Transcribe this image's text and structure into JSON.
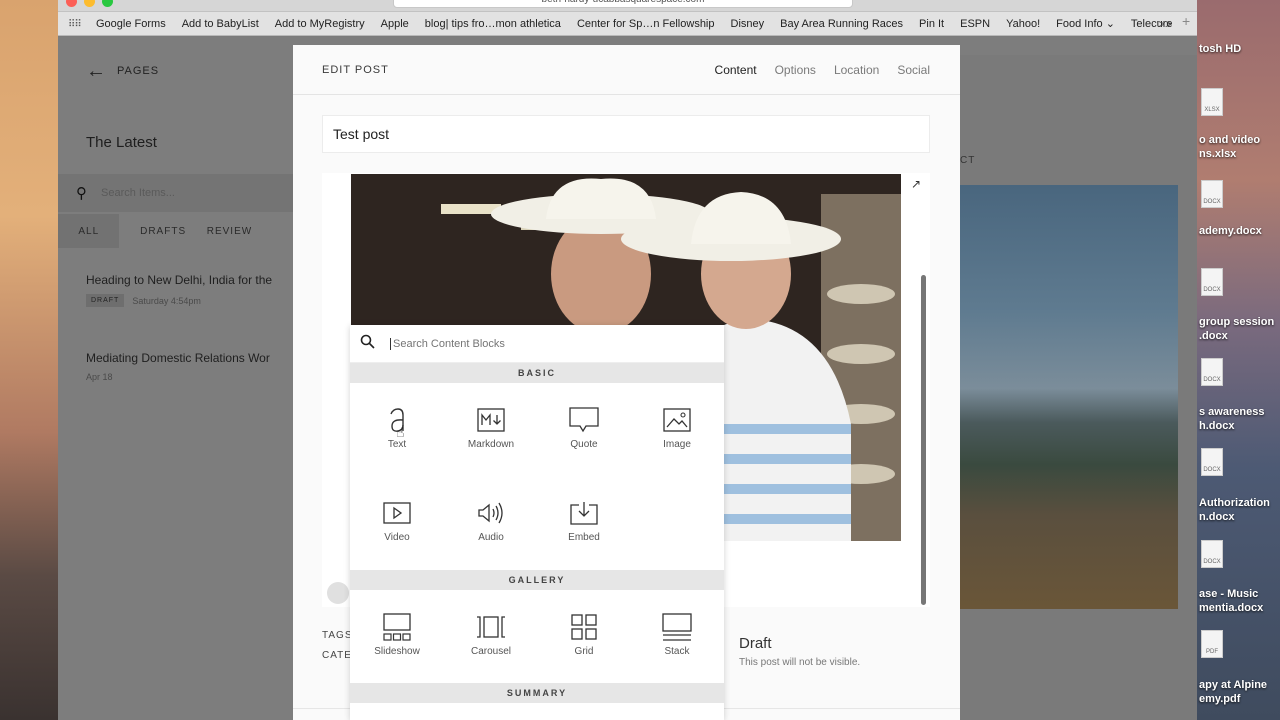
{
  "browser": {
    "url_text": "beth-hardy-ucabbasquarespace.com",
    "bookmarks": [
      "Google Forms",
      "Add to BabyList",
      "Add to MyRegistry",
      "Apple",
      "blog| tips fro…mon athletica",
      "Center for Sp…n Fellowship",
      "Disney",
      "Bay Area Running Races",
      "Pin It",
      "ESPN",
      "Yahoo!",
      "Food Info ⌄",
      "Telecure"
    ],
    "more": ">>",
    "plus": "+"
  },
  "sidebar": {
    "back_label": "PAGES",
    "title": "The Latest",
    "search_placeholder": "Search Items...",
    "tabs": [
      "ALL",
      "DRAFTS",
      "REVIEW"
    ],
    "posts": [
      {
        "title": "Heading to New Delhi, India for the",
        "badge": "DRAFT",
        "date": "Saturday 4:54pm"
      },
      {
        "title": "Mediating Domestic Relations Wor",
        "badge": "",
        "date": "Apr 18"
      }
    ]
  },
  "preview": {
    "label": "CT"
  },
  "modal": {
    "title": "EDIT POST",
    "tabs": [
      "Content",
      "Options",
      "Location",
      "Social"
    ],
    "active_tab": "Content",
    "post_title": "Test post",
    "tags_label": "TAGS",
    "categories_label": "CATE",
    "status_title": "Draft",
    "status_desc": "This post will not be visible."
  },
  "picker": {
    "search_placeholder": "Search Content Blocks",
    "sections": {
      "basic": "BASIC",
      "gallery": "GALLERY",
      "summary": "SUMMARY"
    },
    "basic_items": [
      "Text",
      "Markdown",
      "Quote",
      "Image",
      "Video",
      "Audio",
      "Embed"
    ],
    "gallery_items": [
      "Slideshow",
      "Carousel",
      "Grid",
      "Stack"
    ]
  },
  "desktop": {
    "labels": [
      "tosh HD",
      "o and video",
      "ns.xlsx",
      "ademy.docx",
      "group session",
      ".docx",
      "s awareness",
      "h.docx",
      "Authorization",
      "n.docx",
      "ase - Music",
      "mentia.docx",
      "apy at Alpine",
      "emy.pdf"
    ]
  },
  "colors": {
    "overlay": "#7b7b7b",
    "modal_bg": "#fafafa",
    "accent": "#222222"
  }
}
